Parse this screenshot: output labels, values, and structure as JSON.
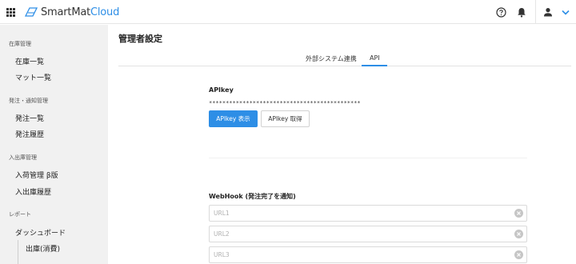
{
  "header": {
    "logo_text_smart": "SmartMat",
    "logo_text_cloud": "Cloud",
    "brand_color": "#2d8ee6",
    "icons": [
      "apps-grid-icon",
      "help-circle-icon",
      "bell-icon",
      "user-icon",
      "chevron-down-icon"
    ]
  },
  "sidebar": {
    "sections": [
      {
        "label": "在庫管理",
        "items": [
          "在庫一覧",
          "マット一覧"
        ]
      },
      {
        "label": "発注・通知管理",
        "items": [
          "発注一覧",
          "発注履歴"
        ]
      },
      {
        "label": "入出庫管理",
        "items": [
          "入荷管理 β版",
          "入出庫履歴"
        ]
      },
      {
        "label": "レポート",
        "items": [
          "ダッシュボード"
        ],
        "subitems": [
          "出庫(消費)"
        ]
      }
    ]
  },
  "main": {
    "page_title": "管理者設定",
    "tabs": [
      {
        "label": "外部システム連携",
        "active": false
      },
      {
        "label": "API",
        "active": true
      }
    ],
    "apikey": {
      "heading": "APIkey",
      "masked_value": "*********************************************",
      "show_button": "APIkey 表示",
      "get_button": "APIkey 取得"
    },
    "webhook": {
      "heading": "WebHook (発注完了を通知)",
      "fields": [
        {
          "placeholder": "URL1",
          "value": ""
        },
        {
          "placeholder": "URL2",
          "value": ""
        },
        {
          "placeholder": "URL3",
          "value": ""
        }
      ]
    }
  }
}
